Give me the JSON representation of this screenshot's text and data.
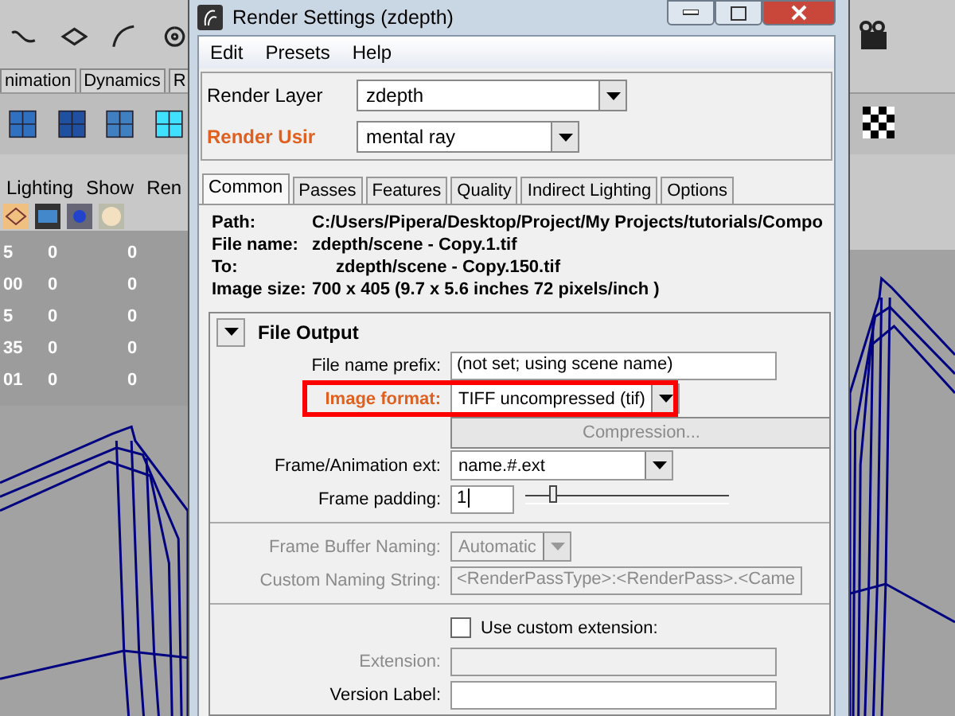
{
  "background_app": {
    "tabs": [
      {
        "label": "nimation",
        "selected": false
      },
      {
        "label": "Dynamics",
        "selected": false
      },
      {
        "label": "R",
        "selected": false
      }
    ],
    "panel_menu": [
      "Lighting",
      "Show",
      "Ren"
    ],
    "channel_rows": [
      [
        "5",
        "0",
        "0"
      ],
      [
        "00",
        "0",
        "0"
      ],
      [
        "5",
        "0",
        "0"
      ],
      [
        "35",
        "0",
        "0"
      ],
      [
        "01",
        "0",
        "0"
      ]
    ]
  },
  "window": {
    "title": "Render Settings (zdepth)"
  },
  "menu": [
    "Edit",
    "Presets",
    "Help"
  ],
  "render_layer": {
    "label": "Render Layer",
    "value": "zdepth",
    "highlighted": false
  },
  "render_using": {
    "label": "Render Usir",
    "value": "mental ray",
    "highlighted": true
  },
  "tabs": [
    {
      "label": "Common",
      "selected": true
    },
    {
      "label": "Passes",
      "selected": false
    },
    {
      "label": "Features",
      "selected": false
    },
    {
      "label": "Quality",
      "selected": false
    },
    {
      "label": "Indirect Lighting",
      "selected": false
    },
    {
      "label": "Options",
      "selected": false
    }
  ],
  "info": [
    {
      "label": "Path:",
      "value": "C:/Users/Pipera/Desktop/Project/My Projects/tutorials/Compo"
    },
    {
      "label": "File name:",
      "value": "zdepth/scene - Copy.1.tif"
    },
    {
      "label": "To:",
      "value": "zdepth/scene - Copy.150.tif"
    },
    {
      "label": "Image size:",
      "value": "700 x 405 (9.7 x 5.6 inches 72 pixels/inch )"
    }
  ],
  "file_output": {
    "title": "File Output",
    "expanded": true,
    "rows": [
      {
        "kind": "text",
        "label": "File name prefix:",
        "value": "(not set; using scene name)",
        "disabled": false
      },
      {
        "kind": "dropdown",
        "label": "Image format:",
        "value": "TIFF uncompressed (tif)",
        "disabled": false,
        "highlighted": true
      },
      {
        "kind": "button",
        "label": "Compression...",
        "disabled": true
      },
      {
        "kind": "dropdown",
        "label": "Frame/Animation ext:",
        "value": "name.#.ext",
        "disabled": false,
        "highlighted": false
      },
      {
        "kind": "slider",
        "label": "Frame padding:",
        "value": "1",
        "level": 0.12
      },
      {
        "kind": "separator"
      },
      {
        "kind": "dropdown",
        "label": "Frame Buffer Naming:",
        "value": "Automatic",
        "disabled": true,
        "highlighted": false
      },
      {
        "kind": "text",
        "label": "Custom Naming String:",
        "value": "<RenderPassType>:<RenderPass>.<Came",
        "disabled": true
      },
      {
        "kind": "separator"
      },
      {
        "kind": "checkbox",
        "label": "Use custom extension:",
        "checked": false
      },
      {
        "kind": "text",
        "label": "Extension:",
        "disabled": true
      },
      {
        "kind": "text",
        "label": "Version Label:",
        "disabled": false
      }
    ]
  }
}
